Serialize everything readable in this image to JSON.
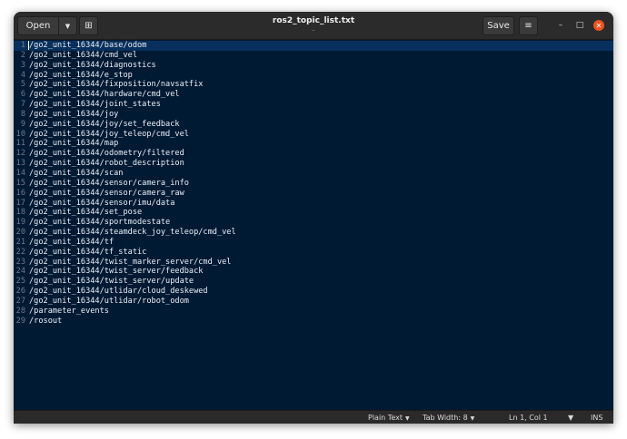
{
  "window": {
    "title": "ros2_topic_list.txt",
    "subtitle": "_"
  },
  "toolbar": {
    "open_label": "Open",
    "open_dropdown_glyph": "▼",
    "new_tab_glyph": "⊞",
    "save_label": "Save",
    "menu_glyph": "≡"
  },
  "window_controls": {
    "minimize": "–",
    "maximize": "□",
    "close": "✕"
  },
  "editor": {
    "lines": [
      {
        "num": "1",
        "text": "/go2_unit_16344/base/odom"
      },
      {
        "num": "2",
        "text": "/go2_unit_16344/cmd_vel"
      },
      {
        "num": "3",
        "text": "/go2_unit_16344/diagnostics"
      },
      {
        "num": "4",
        "text": "/go2_unit_16344/e_stop"
      },
      {
        "num": "5",
        "text": "/go2_unit_16344/fixposition/navsatfix"
      },
      {
        "num": "6",
        "text": "/go2_unit_16344/hardware/cmd_vel"
      },
      {
        "num": "7",
        "text": "/go2_unit_16344/joint_states"
      },
      {
        "num": "8",
        "text": "/go2_unit_16344/joy"
      },
      {
        "num": "9",
        "text": "/go2_unit_16344/joy/set_feedback"
      },
      {
        "num": "10",
        "text": "/go2_unit_16344/joy_teleop/cmd_vel"
      },
      {
        "num": "11",
        "text": "/go2_unit_16344/map"
      },
      {
        "num": "12",
        "text": "/go2_unit_16344/odometry/filtered"
      },
      {
        "num": "13",
        "text": "/go2_unit_16344/robot_description"
      },
      {
        "num": "14",
        "text": "/go2_unit_16344/scan"
      },
      {
        "num": "15",
        "text": "/go2_unit_16344/sensor/camera_info"
      },
      {
        "num": "16",
        "text": "/go2_unit_16344/sensor/camera_raw"
      },
      {
        "num": "17",
        "text": "/go2_unit_16344/sensor/imu/data"
      },
      {
        "num": "18",
        "text": "/go2_unit_16344/set_pose"
      },
      {
        "num": "19",
        "text": "/go2_unit_16344/sportmodestate"
      },
      {
        "num": "20",
        "text": "/go2_unit_16344/steamdeck_joy_teleop/cmd_vel"
      },
      {
        "num": "21",
        "text": "/go2_unit_16344/tf"
      },
      {
        "num": "22",
        "text": "/go2_unit_16344/tf_static"
      },
      {
        "num": "23",
        "text": "/go2_unit_16344/twist_marker_server/cmd_vel"
      },
      {
        "num": "24",
        "text": "/go2_unit_16344/twist_server/feedback"
      },
      {
        "num": "25",
        "text": "/go2_unit_16344/twist_server/update"
      },
      {
        "num": "26",
        "text": "/go2_unit_16344/utlidar/cloud_deskewed"
      },
      {
        "num": "27",
        "text": "/go2_unit_16344/utlidar/robot_odom"
      },
      {
        "num": "28",
        "text": "/parameter_events"
      },
      {
        "num": "29",
        "text": "/rosout"
      }
    ]
  },
  "statusbar": {
    "language": "Plain Text",
    "tab_width": "Tab Width: 8",
    "cursor_position": "Ln 1, Col 1",
    "insert_mode": "INS",
    "dropdown_glyph": "▼"
  },
  "colors": {
    "editor_background": "#011a33",
    "current_line": "#08305c",
    "close_button": "#e95420"
  }
}
